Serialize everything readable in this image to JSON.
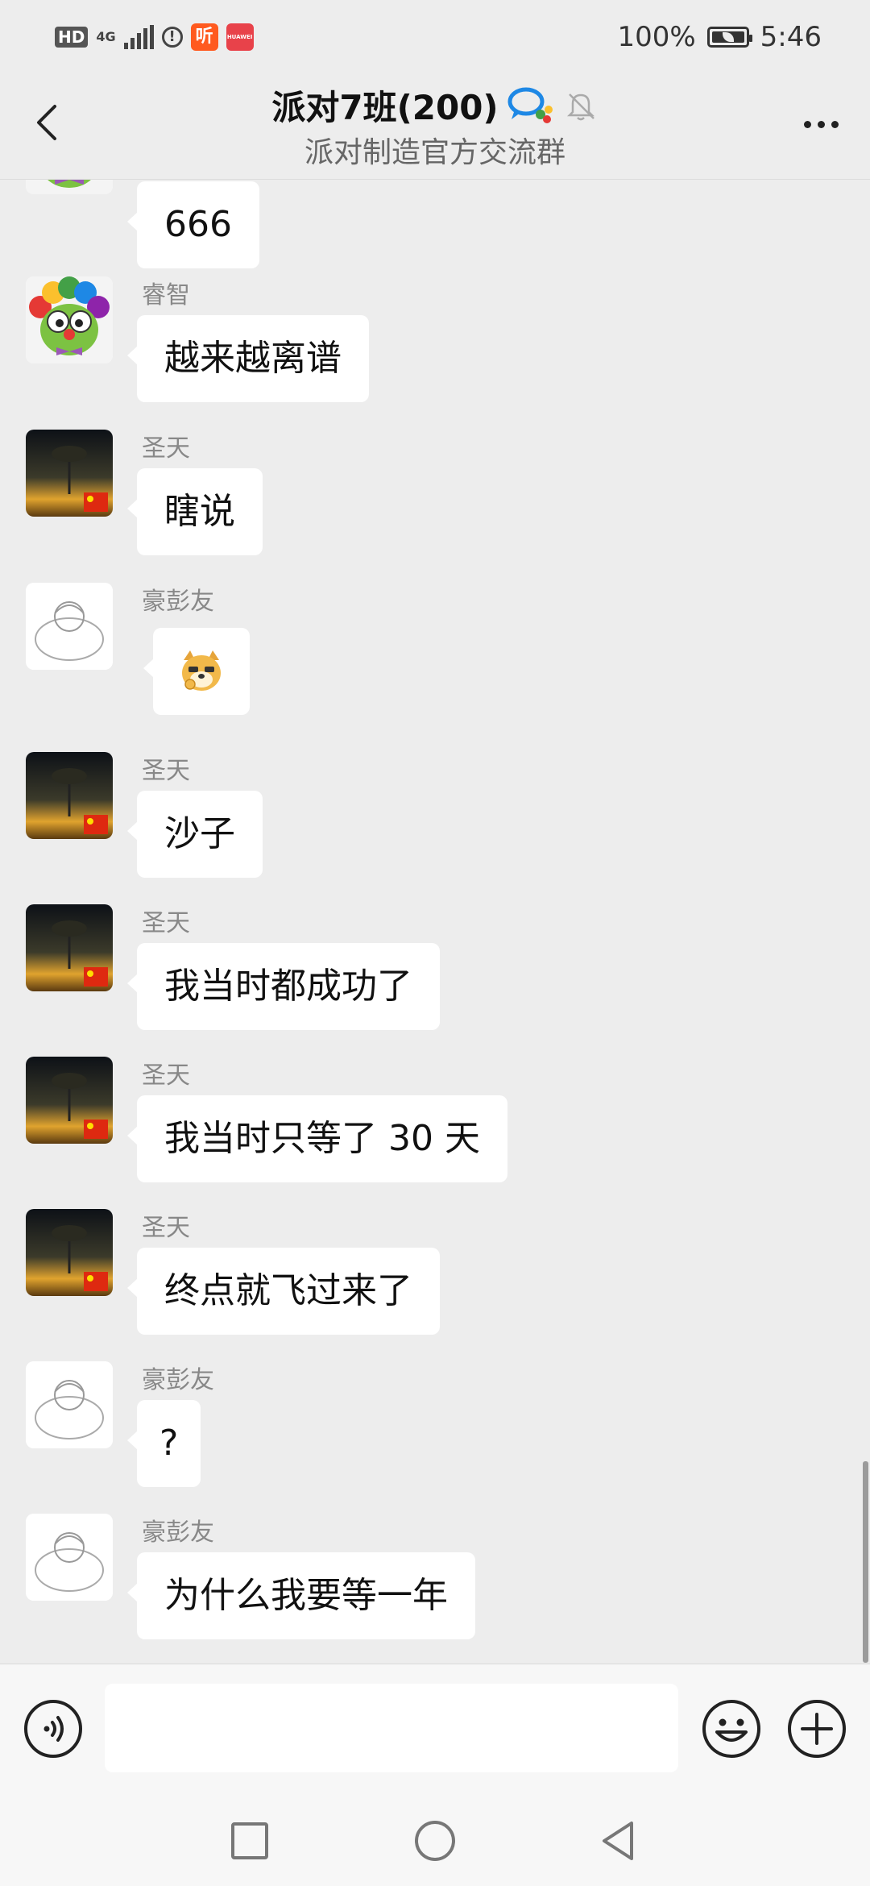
{
  "status_bar": {
    "hd": "HD",
    "network": "4G",
    "app1_glyph": "听",
    "app2_label": "HUAWEI",
    "battery": "100%",
    "time": "5:46"
  },
  "header": {
    "title": "派对7班(200)",
    "subtitle": "派对制造官方交流群"
  },
  "messages": [
    {
      "sender": "",
      "text": "666",
      "avatar": "clown-frog"
    },
    {
      "sender": "睿智",
      "text": "越来越离谱",
      "avatar": "clown-frog"
    },
    {
      "sender": "圣天",
      "text": "瞎说",
      "avatar": "tree-sunset"
    },
    {
      "sender": "豪彭友",
      "text": "",
      "avatar": "sketch",
      "sticker": "doge-emoji"
    },
    {
      "sender": "圣天",
      "text": "沙子",
      "avatar": "tree-sunset"
    },
    {
      "sender": "圣天",
      "text": "我当时都成功了",
      "avatar": "tree-sunset"
    },
    {
      "sender": "圣天",
      "text": "我当时只等了 30 天",
      "avatar": "tree-sunset"
    },
    {
      "sender": "圣天",
      "text": "终点就飞过来了",
      "avatar": "tree-sunset"
    },
    {
      "sender": "豪彭友",
      "text": "?",
      "avatar": "sketch"
    },
    {
      "sender": "豪彭友",
      "text": "为什么我要等一年",
      "avatar": "sketch"
    }
  ],
  "input": {
    "value": ""
  },
  "icons": {
    "back": "chevron-left-icon",
    "group_badge": "chat-bubbles-icon",
    "mute": "bell-off-icon",
    "more": "more-dots-icon",
    "voice": "voice-icon",
    "emoji": "smiley-icon",
    "plus": "plus-icon"
  }
}
